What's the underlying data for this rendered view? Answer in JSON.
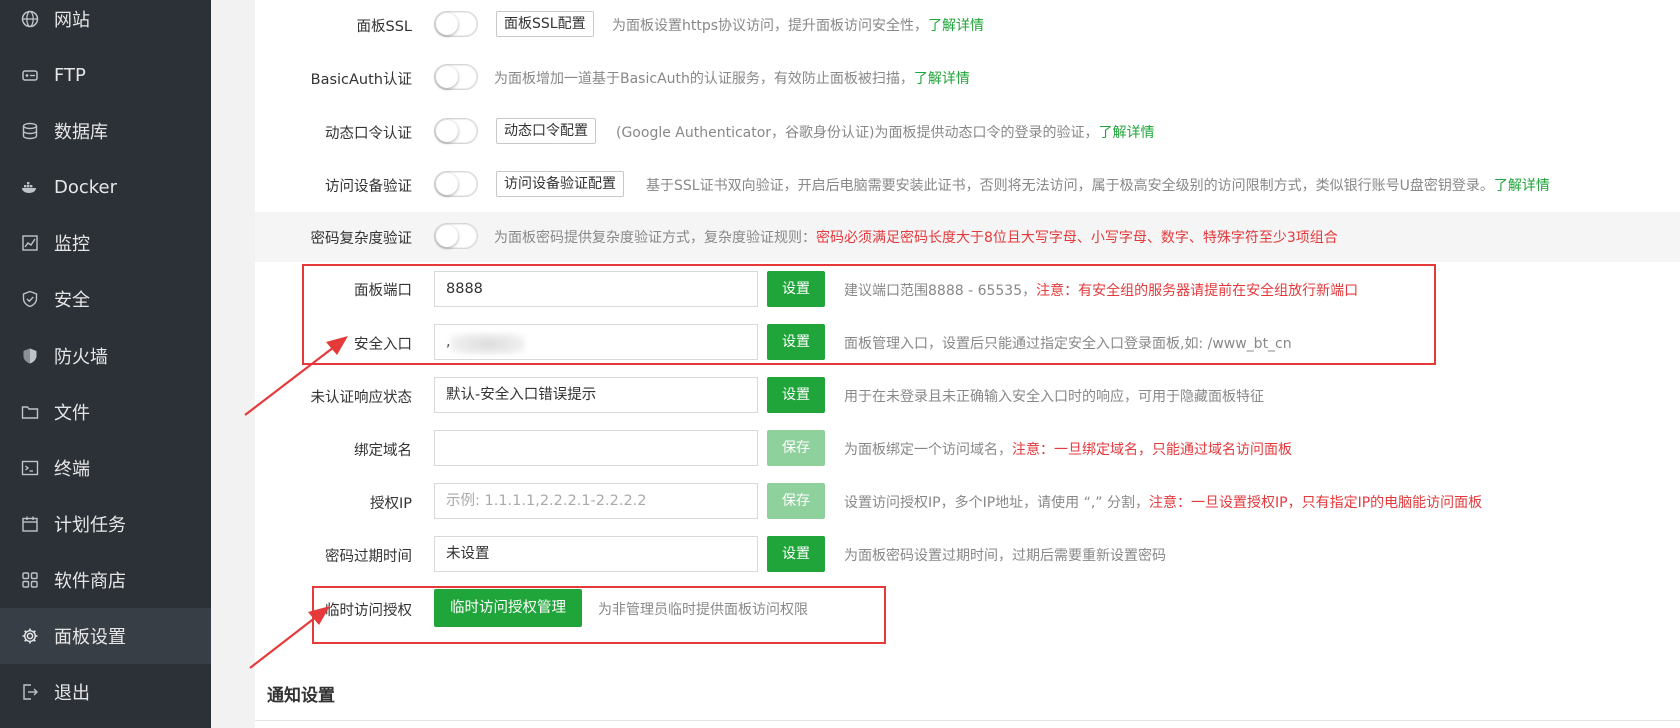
{
  "sidebar": {
    "items": [
      {
        "label": "网站",
        "icon": "globe-icon"
      },
      {
        "label": "FTP",
        "icon": "ftp-icon"
      },
      {
        "label": "数据库",
        "icon": "database-icon"
      },
      {
        "label": "Docker",
        "icon": "docker-icon"
      },
      {
        "label": "监控",
        "icon": "monitor-icon"
      },
      {
        "label": "安全",
        "icon": "shield-check-icon"
      },
      {
        "label": "防火墙",
        "icon": "firewall-shield-icon"
      },
      {
        "label": "文件",
        "icon": "folder-icon"
      },
      {
        "label": "终端",
        "icon": "terminal-icon"
      },
      {
        "label": "计划任务",
        "icon": "calendar-icon"
      },
      {
        "label": "软件商店",
        "icon": "grid-apps-icon"
      },
      {
        "label": "面板设置",
        "icon": "gear-icon",
        "active": true
      },
      {
        "label": "退出",
        "icon": "logout-icon"
      }
    ]
  },
  "settings": {
    "ssl": {
      "label": "面板SSL",
      "button": "面板SSL配置",
      "desc": "为面板设置https协议访问，提升面板访问安全性，",
      "link": "了解详情",
      "enabled": false
    },
    "basicauth": {
      "label": "BasicAuth认证",
      "desc": "为面板增加一道基于BasicAuth的认证服务，有效防止面板被扫描，",
      "link": "了解详情",
      "enabled": false
    },
    "dynamic": {
      "label": "动态口令认证",
      "button": "动态口令配置",
      "desc": "(Google Authenticator，谷歌身份认证)为面板提供动态口令的登录的验证，",
      "link": "了解详情",
      "enabled": false
    },
    "device": {
      "label": "访问设备验证",
      "button": "访问设备验证配置",
      "desc": "基于SSL证书双向验证，开启后电脑需要安装此证书，否则将无法访问，属于极高安全级别的访问限制方式，类似银行账号U盘密钥登录。",
      "link": "了解详情",
      "enabled": false
    },
    "pwdcomplex": {
      "label": "密码复杂度验证",
      "desc": "为面板密码提供复杂度验证方式，复杂度验证规则：",
      "red": "密码必须满足密码长度大于8位且大写字母、小写字母、数字、特殊字符至少3项组合",
      "enabled": false
    },
    "port": {
      "label": "面板端口",
      "value": "8888",
      "button": "设置",
      "desc": "建议端口范围8888 - 65535，",
      "red": "注意：有安全组的服务器请提前在安全组放行新端口"
    },
    "entry": {
      "label": "安全入口",
      "value": ",",
      "button": "设置",
      "desc": "面板管理入口，设置后只能通过指定安全入口登录面板,如: /www_bt_cn"
    },
    "unauth": {
      "label": "未认证响应状态",
      "value": "默认-安全入口错误提示",
      "button": "设置",
      "desc": "用于在未登录且未正确输入安全入口时的响应，可用于隐藏面板特征"
    },
    "domain": {
      "label": "绑定域名",
      "value": "",
      "button": "保存",
      "desc": "为面板绑定一个访问域名，",
      "red": "注意：一旦绑定域名，只能通过域名访问面板"
    },
    "authip": {
      "label": "授权IP",
      "placeholder": "示例: 1.1.1.1,2.2.2.1-2.2.2.2",
      "button": "保存",
      "desc": "设置访问授权IP，多个IP地址，请使用 “,” 分割，",
      "red": "注意：一旦设置授权IP，只有指定IP的电脑能访问面板"
    },
    "pwdexpire": {
      "label": "密码过期时间",
      "value": "未设置",
      "button": "设置",
      "desc": "为面板密码设置过期时间，过期后需要重新设置密码"
    },
    "tempauth": {
      "label": "临时访问授权",
      "button": "临时访问授权管理",
      "desc": "为非管理员临时提供面板访问权限"
    }
  },
  "notify": {
    "title": "通知设置"
  },
  "colors": {
    "accent": "#20a53a",
    "sidebar": "#2c3138",
    "highlight": "#e63a3a",
    "warning": "#e4393c"
  }
}
